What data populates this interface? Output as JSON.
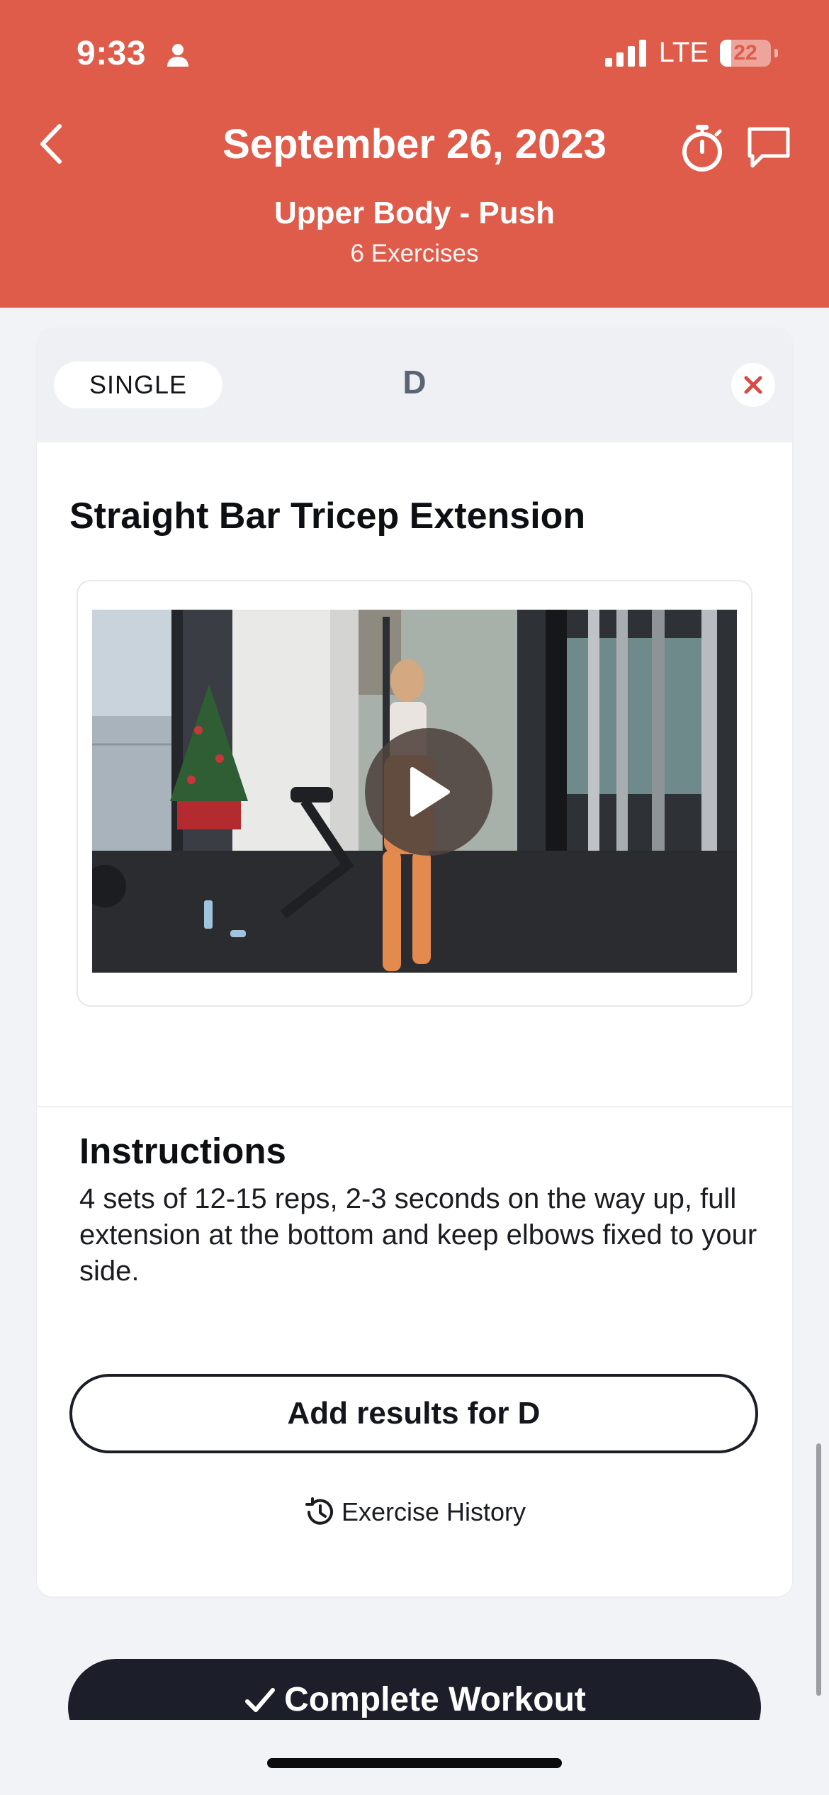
{
  "status_bar": {
    "time": "9:33",
    "network": "LTE",
    "battery": "22",
    "battery_level": 0.22
  },
  "header": {
    "title": "September 26, 2023",
    "workout_name": "Upper Body - Push",
    "exercise_count": "6 Exercises",
    "color": "#df5b4a"
  },
  "exercise_card": {
    "badge": "SINGLE",
    "letter": "D",
    "title": "Straight Bar Tricep Extension",
    "instructions_heading": "Instructions",
    "instructions_text": "4 sets of 12-15 reps, 2-3 seconds on the way up, full extension at the bottom and keep elbows fixed to your side.",
    "add_results_label": "Add results for D",
    "history_label": "Exercise History"
  },
  "footer": {
    "complete_label": "Complete Workout"
  },
  "icons": {
    "back": "chevron-left-icon",
    "timer": "stopwatch-icon",
    "chat": "chat-bubble-icon",
    "close": "close-icon",
    "play": "play-icon",
    "history": "history-icon",
    "check": "checkmark-icon"
  }
}
